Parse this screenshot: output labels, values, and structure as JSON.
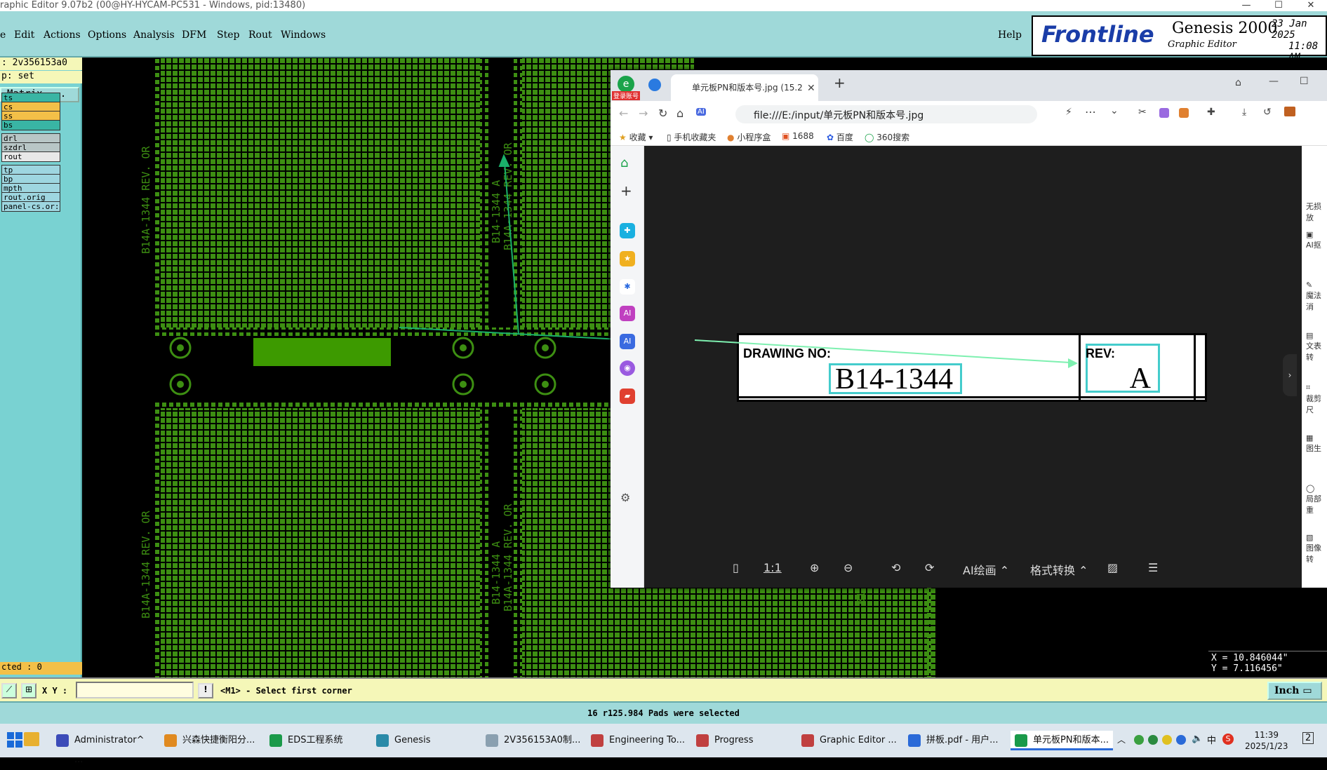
{
  "window": {
    "title": "raphic Editor 9.07b2 (00@HY-HYCAM-PC531 - Windows, pid:13480)"
  },
  "menubar": {
    "items": [
      {
        "label": "e"
      },
      {
        "label": "Edit"
      },
      {
        "label": "Actions"
      },
      {
        "label": "Options"
      },
      {
        "label": "Analysis"
      },
      {
        "label": "DFM"
      },
      {
        "label": "Step"
      },
      {
        "label": "Rout"
      },
      {
        "label": "Windows"
      }
    ],
    "help": "Help"
  },
  "logo": {
    "brand": "Frontline",
    "product": "Genesis 2000",
    "subtitle": "Graphic Editor",
    "date": "23 Jan 2025",
    "time": "11:08 AM"
  },
  "leftpanel": {
    "job": ": 2v356153a0",
    "step": "p: set",
    "matrix_button": "Matrix ...",
    "layers": [
      {
        "name": "ts",
        "color": "#39b5a4"
      },
      {
        "name": "cs",
        "color": "#f3c048"
      },
      {
        "name": "ss",
        "color": "#f3c048"
      },
      {
        "name": "bs",
        "color": "#39b5a4"
      },
      {
        "name": "drl",
        "color": "#b8c6c6"
      },
      {
        "name": "szdrl",
        "color": "#b8c6c6"
      },
      {
        "name": "rout",
        "color": "#e8e8e8"
      },
      {
        "name": "tp",
        "color": "#9ed6e0"
      },
      {
        "name": "bp",
        "color": "#9ed6e0"
      },
      {
        "name": "mpth",
        "color": "#9ed6e0"
      },
      {
        "name": "rout.orig",
        "color": "#9ed6e0"
      },
      {
        "name": "panel-cs.or:",
        "color": "#9ed6e0"
      }
    ],
    "selected": "cted : 0"
  },
  "pcb": {
    "text_rev": "B14A-1344 REV. OR",
    "text_part": "B14-1344 A",
    "text_fragment": "B1"
  },
  "browser": {
    "tab_title": "单元板PN和版本号.jpg (15.2",
    "new_tab": "+",
    "url": "file:///E:/input/单元板PN和版本号.jpg",
    "bookmarks": [
      "收藏",
      "手机收藏夹",
      "小程序盒",
      "1688",
      "百度",
      "360搜索"
    ],
    "login_badge": "登录账号",
    "viewer_toolbar": {
      "ratio": "1:1",
      "ai_paint": "AI绘画",
      "format_convert": "格式转换"
    },
    "right_rail": [
      "无损放",
      "AI抠",
      "魔法消",
      "文表转",
      "裁剪尺",
      "图生",
      "局部重",
      "图像转"
    ]
  },
  "drawing": {
    "drawing_no_label": "DRAWING  NO:",
    "drawing_no_value": "B14-1344",
    "rev_label": "REV:",
    "rev_value": "A"
  },
  "coords": {
    "x": "X = 10.846044\"",
    "y": "Y = 7.116456\""
  },
  "cmdbar": {
    "xy_label": "X Y :",
    "xy_value": "",
    "prompt": "<M1> - Select first corner",
    "unit": "Inch"
  },
  "status": {
    "message": "16 r125.984 Pads were selected"
  },
  "taskbar": {
    "items": [
      {
        "label": "Administrator^ ...",
        "color": "#3b4bb8"
      },
      {
        "label": "兴森快捷衡阳分...",
        "color": "#e08a20"
      },
      {
        "label": "EDS工程系统",
        "color": "#1a9a4a"
      },
      {
        "label": "Genesis",
        "color": "#2a8aa8"
      },
      {
        "label": "2V356153A0制...",
        "color": "#8aa0b0"
      },
      {
        "label": "Engineering To...",
        "color": "#c04040"
      },
      {
        "label": "Progress",
        "color": "#c04040"
      },
      {
        "label": "Graphic Editor ...",
        "color": "#c04040"
      },
      {
        "label": "拼板.pdf - 用户...",
        "color": "#2a6ad8"
      },
      {
        "label": "单元板PN和版本...",
        "color": "#1a9a4a"
      }
    ],
    "ime": "中",
    "time": "11:39",
    "date": "2025/1/23",
    "notif": "2"
  },
  "colors": {
    "menubar": "#9fd9d9",
    "panel": "#79d2d2",
    "pcb_green": "#3a8c10",
    "cmd_bg": "#f5f7b8"
  }
}
